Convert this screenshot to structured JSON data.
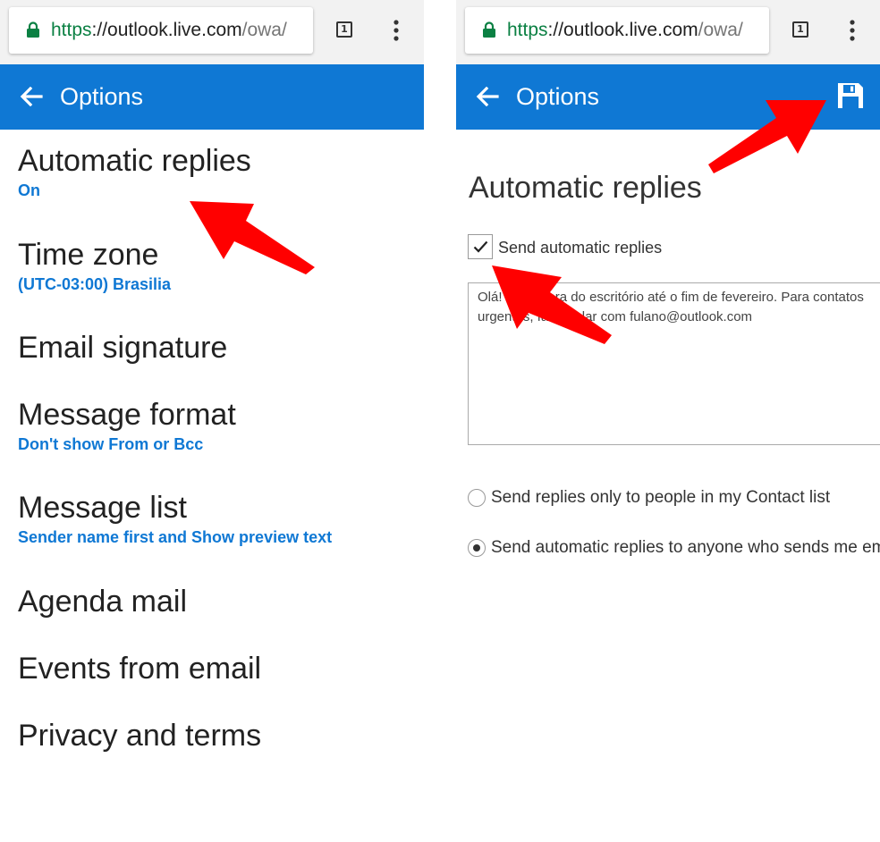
{
  "left": {
    "browser": {
      "url_scheme": "https",
      "url_separator": "://",
      "url_host": "outlook.live.com",
      "url_path": "/owa/",
      "tab_count": "1",
      "lock_icon": "lock-icon",
      "menu_icon": "kebab-menu-icon"
    },
    "header": {
      "title": "Options",
      "back_icon": "back-arrow-icon"
    },
    "options": [
      {
        "title": "Automatic replies",
        "subtitle": "On"
      },
      {
        "title": "Time zone",
        "subtitle": "(UTC-03:00) Brasilia"
      },
      {
        "title": "Email signature",
        "subtitle": ""
      },
      {
        "title": "Message format",
        "subtitle": "Don't show From or Bcc"
      },
      {
        "title": "Message list",
        "subtitle": "Sender name first and Show preview text"
      },
      {
        "title": "Agenda mail",
        "subtitle": ""
      },
      {
        "title": "Events from email",
        "subtitle": ""
      },
      {
        "title": "Privacy and terms",
        "subtitle": ""
      }
    ]
  },
  "right": {
    "browser": {
      "url_scheme": "https",
      "url_separator": "://",
      "url_host": "outlook.live.com",
      "url_path": "/owa/",
      "tab_count": "1"
    },
    "header": {
      "title": "Options",
      "save_icon": "save-floppy-icon"
    },
    "heading": "Automatic replies",
    "send_automatic_replies": {
      "label": "Send automatic replies",
      "checked": true
    },
    "reply_message": "Olá! Estou fora do escritório até o fim de fevereiro. Para contatos urgentes, favor falar com fulano@outlook.com",
    "radio_options": [
      {
        "label": "Send replies only to people in my Contact list",
        "selected": false
      },
      {
        "label": "Send automatic replies to anyone who sends me email",
        "selected": true
      }
    ]
  },
  "colors": {
    "header_blue": "#0f78d4",
    "link_blue": "#0f78d4",
    "secure_green": "#0b8043",
    "annotation_red": "#ff0000"
  }
}
